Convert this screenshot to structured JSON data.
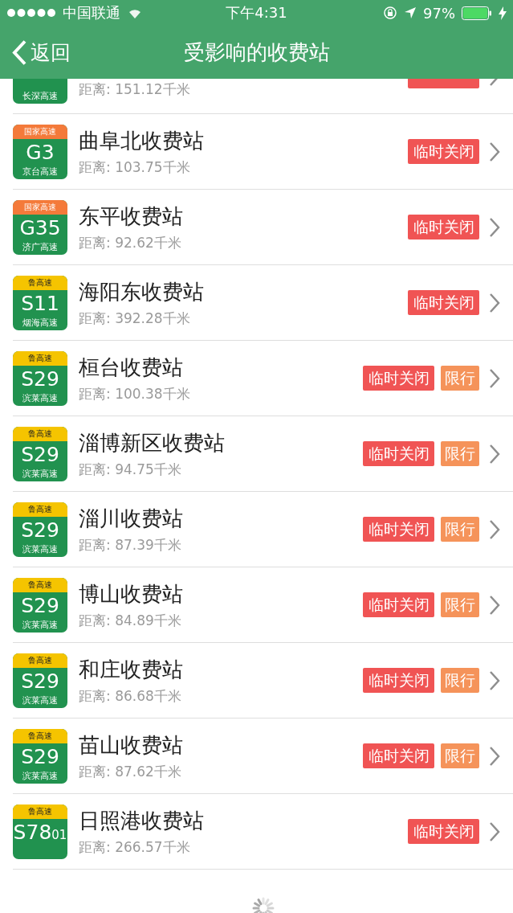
{
  "status_bar": {
    "carrier": "中国联通",
    "time": "下午4:31",
    "battery": "97%"
  },
  "nav": {
    "back": "返回",
    "title": "受影响的收费站"
  },
  "stations": [
    {
      "road": "长深高速",
      "distance": "距离: 151.12千米",
      "tags": [
        {
          "kind": "closed"
        }
      ]
    },
    {
      "network": "国家高速",
      "color": "#f47a3a",
      "code": "G3",
      "road": "京台高速",
      "name": "曲阜北收费站",
      "distance": "距离: 103.75千米",
      "tags": [
        {
          "kind": "closed",
          "label": "临时关闭"
        }
      ]
    },
    {
      "network": "国家高速",
      "color": "#f47a3a",
      "code": "G35",
      "road": "济广高速",
      "name": "东平收费站",
      "distance": "距离: 92.62千米",
      "tags": [
        {
          "kind": "closed",
          "label": "临时关闭"
        }
      ]
    },
    {
      "network": "鲁高速",
      "color": "#f5c400",
      "code": "S11",
      "road": "烟海高速",
      "name": "海阳东收费站",
      "distance": "距离: 392.28千米",
      "tags": [
        {
          "kind": "closed",
          "label": "临时关闭"
        }
      ]
    },
    {
      "network": "鲁高速",
      "color": "#f5c400",
      "code": "S29",
      "road": "滨莱高速",
      "name": "桓台收费站",
      "distance": "距离: 100.38千米",
      "tags": [
        {
          "kind": "closed",
          "label": "临时关闭"
        },
        {
          "kind": "limited",
          "label": "限行"
        }
      ]
    },
    {
      "network": "鲁高速",
      "color": "#f5c400",
      "code": "S29",
      "road": "滨莱高速",
      "name": "淄博新区收费站",
      "distance": "距离: 94.75千米",
      "tags": [
        {
          "kind": "closed",
          "label": "临时关闭"
        },
        {
          "kind": "limited",
          "label": "限行"
        }
      ]
    },
    {
      "network": "鲁高速",
      "color": "#f5c400",
      "code": "S29",
      "road": "滨莱高速",
      "name": "淄川收费站",
      "distance": "距离: 87.39千米",
      "tags": [
        {
          "kind": "closed",
          "label": "临时关闭"
        },
        {
          "kind": "limited",
          "label": "限行"
        }
      ]
    },
    {
      "network": "鲁高速",
      "color": "#f5c400",
      "code": "S29",
      "road": "滨莱高速",
      "name": "博山收费站",
      "distance": "距离: 84.89千米",
      "tags": [
        {
          "kind": "closed",
          "label": "临时关闭"
        },
        {
          "kind": "limited",
          "label": "限行"
        }
      ]
    },
    {
      "network": "鲁高速",
      "color": "#f5c400",
      "code": "S29",
      "road": "滨莱高速",
      "name": "和庄收费站",
      "distance": "距离: 86.68千米",
      "tags": [
        {
          "kind": "closed",
          "label": "临时关闭"
        },
        {
          "kind": "limited",
          "label": "限行"
        }
      ]
    },
    {
      "network": "鲁高速",
      "color": "#f5c400",
      "code": "S29",
      "road": "滨莱高速",
      "name": "苗山收费站",
      "distance": "距离: 87.62千米",
      "tags": [
        {
          "kind": "closed",
          "label": "临时关闭"
        },
        {
          "kind": "limited",
          "label": "限行"
        }
      ]
    },
    {
      "network": "鲁高速",
      "color": "#f5c400",
      "code": "S78$_{01}$",
      "name": "日照港收费站",
      "distance": "距离: 266.57千米",
      "tags": [
        {
          "kind": "closed",
          "label": "临时关闭"
        }
      ]
    }
  ]
}
